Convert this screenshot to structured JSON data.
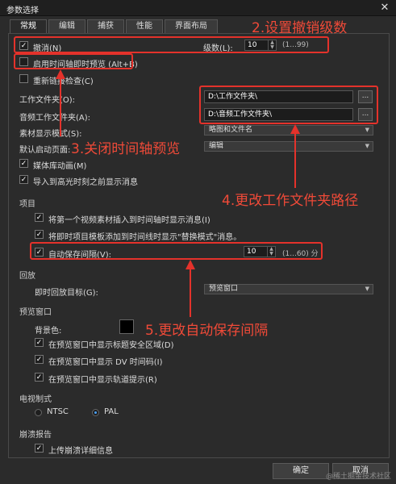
{
  "window": {
    "title": "参数选择",
    "close_glyph": "✕"
  },
  "tabs": [
    "常规",
    "编辑",
    "捕获",
    "性能",
    "界面布局"
  ],
  "general": {
    "undo": {
      "label": "撤消(N)",
      "checked": true,
      "levels_label": "级数(L):",
      "levels_value": "10",
      "levels_range": "(1...99)"
    },
    "timeline_preview": {
      "label": "启用时间轴即时预览 (Alt+B)",
      "checked": false
    },
    "relink": {
      "label": "重新链接检查(C)",
      "checked": false
    },
    "work_folder": {
      "label": "工作文件夹(O):",
      "value": "D:\\工作文件夹\\",
      "browse": "..."
    },
    "audio_folder": {
      "label": "音频工作文件夹(A):",
      "value": "D:\\音频工作文件夹\\",
      "browse": "..."
    },
    "display_mode": {
      "label": "素材显示模式(S):",
      "value": "略图和文件名"
    },
    "default_page": {
      "label": "默认启动页面:",
      "value": "编辑"
    },
    "media_anim": {
      "label": "媒体库动画(M)",
      "checked": true
    },
    "import_msg": {
      "label": "导入到高光时刻之前显示消息",
      "checked": true
    }
  },
  "project": {
    "section": "项目",
    "insert_msg": {
      "label": "将第一个视频素材插入到时间轴时显示消息(I)",
      "checked": true
    },
    "template_msg": {
      "label": "将即时项目模板添加到时间线时显示\"替换模式\"消息。",
      "checked": true
    },
    "autosave": {
      "label": "自动保存间隔(V):",
      "checked": true,
      "value": "10",
      "range": "(1...60) 分"
    }
  },
  "playback": {
    "section": "回放",
    "target_label": "即时回放目标(G):",
    "target_value": "预览窗口"
  },
  "preview": {
    "section": "预览窗口",
    "bg_label": "背景色:",
    "bg_color": "#000000",
    "safe_area": {
      "label": "在预览窗口中显示标题安全区域(D)",
      "checked": true
    },
    "dv_timecode": {
      "label": "在预览窗口中显示 DV 时间码(I)",
      "checked": true
    },
    "track_hint": {
      "label": "在预览窗口中显示轨道提示(R)",
      "checked": true
    }
  },
  "tv": {
    "section": "电视制式",
    "ntsc": "NTSC",
    "pal": "PAL",
    "selected": "PAL"
  },
  "crash": {
    "section": "崩溃报告",
    "upload": {
      "label": "上传崩溃详细信息",
      "checked": true
    }
  },
  "buttons": {
    "ok": "确定",
    "cancel": "取消"
  },
  "annotations": {
    "a2": "2.设置撤销级数",
    "a3": "3.关闭时间轴预览",
    "a4": "4.更改工作文件夹路径",
    "a5": "5.更改自动保存间隔"
  },
  "watermark": "@稀土掘金技术社区",
  "colors": {
    "annotation": "#e4322b",
    "accent": "#4aa3ff",
    "background": "#2b2b2b"
  }
}
